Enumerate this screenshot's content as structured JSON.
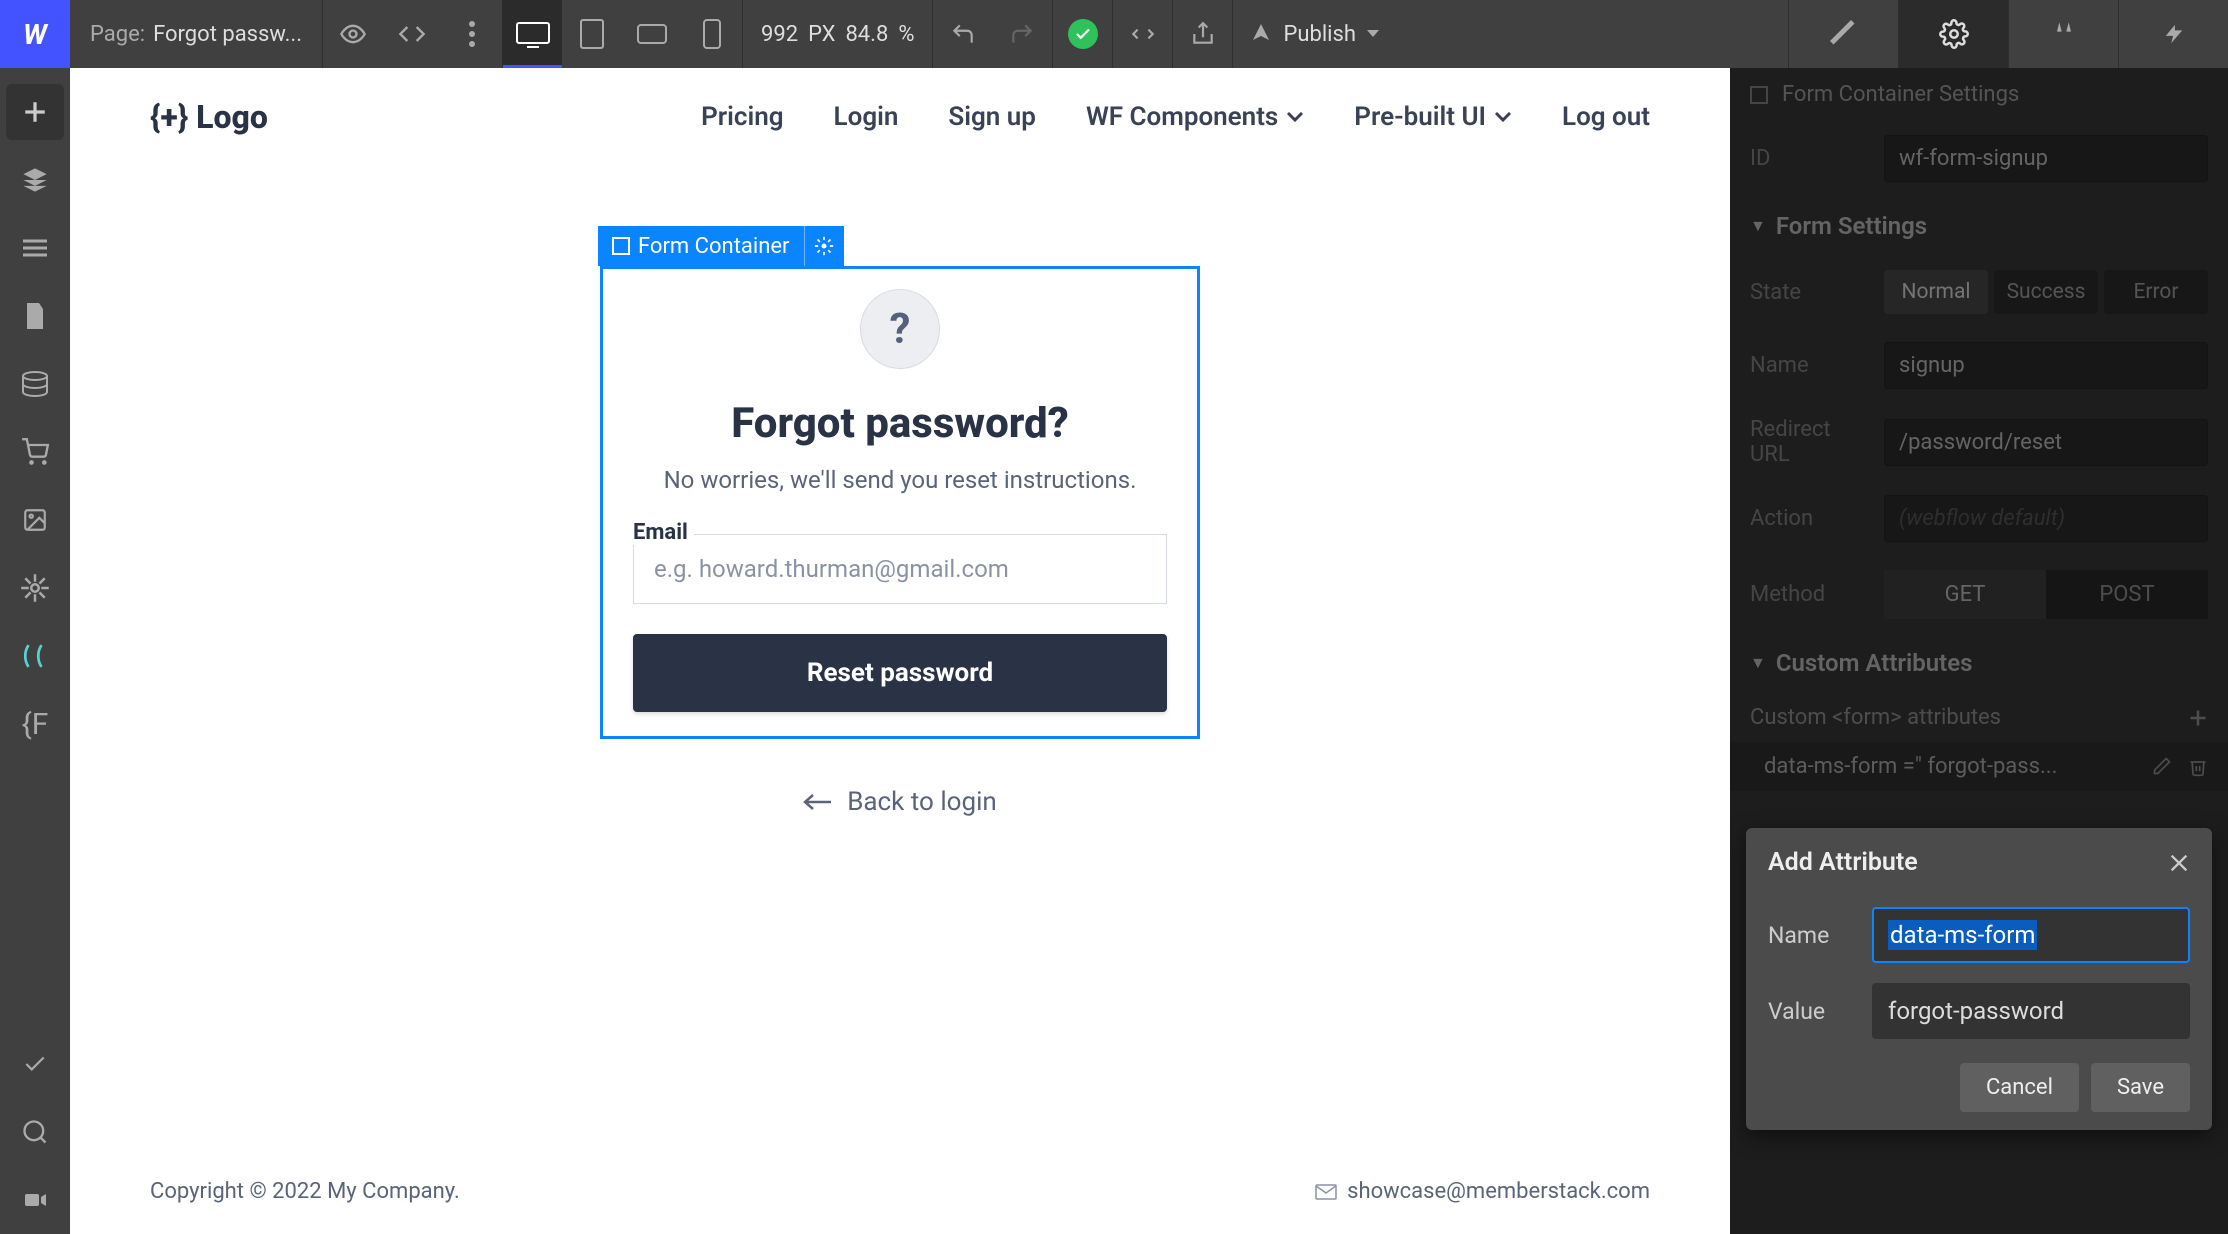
{
  "topbar": {
    "page_label": "Page:",
    "page_name": "Forgot passw...",
    "canvas_width": "992",
    "canvas_unit": "PX",
    "zoom_value": "84.8",
    "zoom_unit": "%",
    "publish_label": "Publish"
  },
  "canvas_site": {
    "logo_text": "{+} Logo",
    "nav": {
      "pricing": "Pricing",
      "login": "Login",
      "signup": "Sign up",
      "wf_components": "WF Components",
      "prebuilt_ui": "Pre-built UI",
      "logout": "Log out"
    },
    "form": {
      "badge_label": "Form Container",
      "icon_glyph": "?",
      "title": "Forgot password?",
      "subtitle": "No worries, we'll send you reset instructions.",
      "email_label": "Email",
      "email_placeholder": "e.g. howard.thurman@gmail.com",
      "submit_label": "Reset password",
      "back_label": "Back to login"
    },
    "footer": {
      "copyright": "Copyright © 2022 My Company.",
      "email": "showcase@memberstack.com"
    }
  },
  "settings_panel": {
    "element_label": "Form Container Settings",
    "id_label": "ID",
    "id_value": "wf-form-signup",
    "form_settings_heading": "Form Settings",
    "state_label": "State",
    "state_options": {
      "normal": "Normal",
      "success": "Success",
      "error": "Error"
    },
    "name_label": "Name",
    "name_value": "signup",
    "redirect_label_l1": "Redirect",
    "redirect_label_l2": "URL",
    "redirect_value": "/password/reset",
    "action_label": "Action",
    "action_placeholder": "(webflow default)",
    "method_label": "Method",
    "method_get": "GET",
    "method_post": "POST",
    "custom_attr_heading": "Custom Attributes",
    "custom_form_attr_label": "Custom <form> attributes",
    "attr_entry_text": "data-ms-form =\" forgot-pass..."
  },
  "add_attribute_popover": {
    "title": "Add Attribute",
    "name_label": "Name",
    "name_value": "data-ms-form",
    "value_label": "Value",
    "value_value": "forgot-password",
    "cancel_label": "Cancel",
    "save_label": "Save"
  }
}
